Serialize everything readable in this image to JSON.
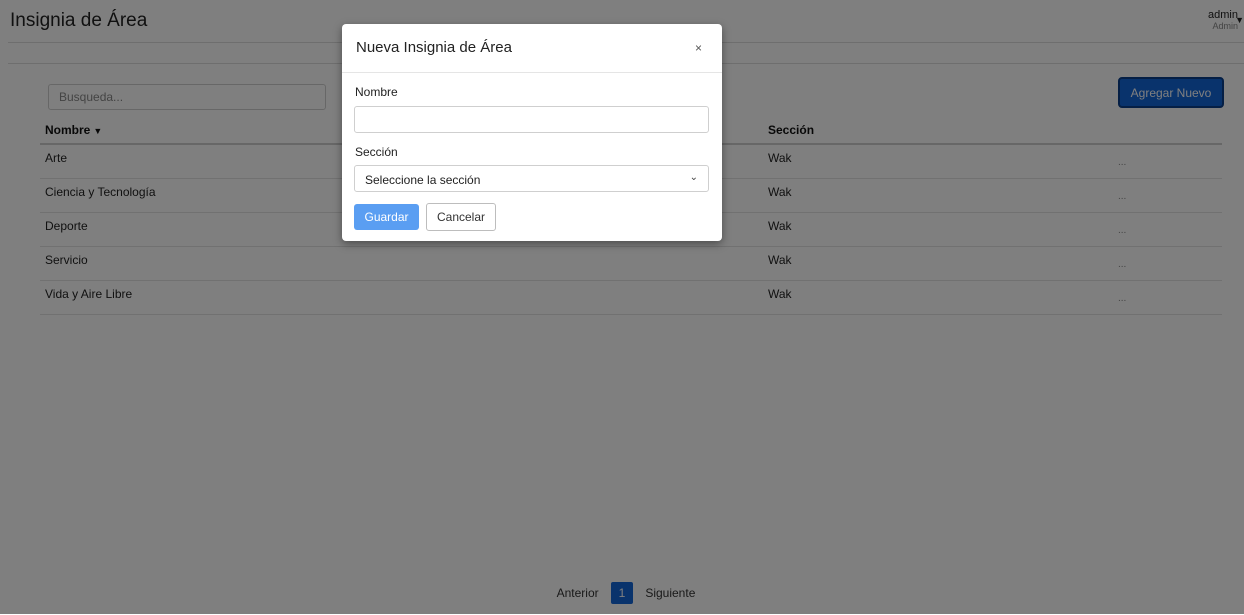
{
  "header": {
    "title": "Insignia de Área",
    "user_name": "admin",
    "user_role": "Admin"
  },
  "search": {
    "placeholder": "Busqueda..."
  },
  "toolbar": {
    "add_label": "Agregar Nuevo"
  },
  "table": {
    "columns": {
      "name": "Nombre",
      "section": "Sección"
    },
    "rows": [
      {
        "name": "Arte",
        "section": "Wak",
        "menu": "..."
      },
      {
        "name": "Ciencia y Tecnología",
        "section": "Wak",
        "menu": "..."
      },
      {
        "name": "Deporte",
        "section": "Wak",
        "menu": "..."
      },
      {
        "name": "Servicio",
        "section": "Wak",
        "menu": "..."
      },
      {
        "name": "Vida y Aire Libre",
        "section": "Wak",
        "menu": "..."
      }
    ]
  },
  "pagination": {
    "prev": "Anterior",
    "current": "1",
    "next": "Siguiente"
  },
  "modal": {
    "title": "Nueva Insignia de Área",
    "close": "×",
    "name_label": "Nombre",
    "name_value": "",
    "section_label": "Sección",
    "section_selected": "Seleccione la sección",
    "save_label": "Guardar",
    "cancel_label": "Cancelar"
  },
  "colors": {
    "primary": "#1366d8",
    "primary_light": "#5a9ef2",
    "overlay": "rgba(0,0,0,0.5)"
  },
  "icons": {
    "sort": "caret-down-icon",
    "close": "close-icon",
    "select": "chevron-down-icon",
    "user_menu": "caret-down-icon"
  }
}
